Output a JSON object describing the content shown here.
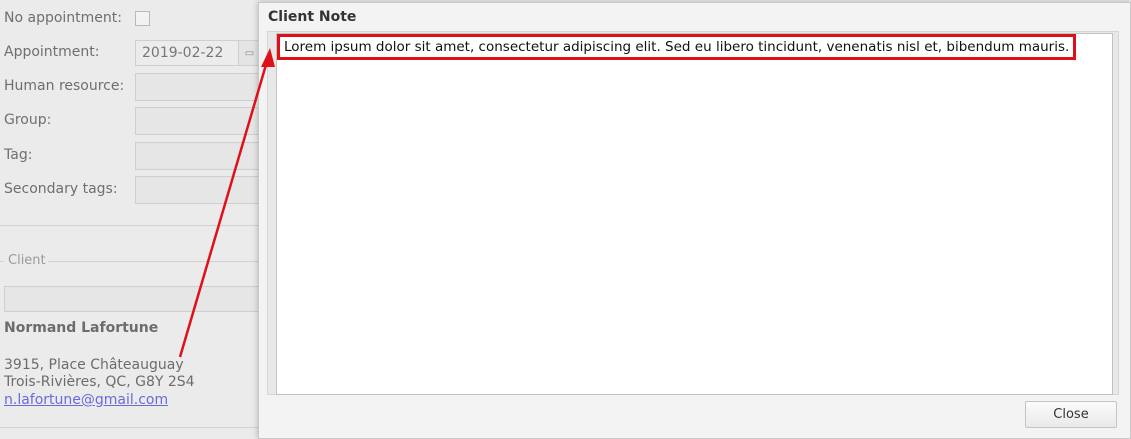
{
  "form": {
    "no_appointment_label": "No appointment:",
    "appointment_label": "Appointment:",
    "appointment_value": "2019-02-22",
    "human_resource_label": "Human resource:",
    "group_label": "Group:",
    "tag_label": "Tag:",
    "secondary_tags_label": "Secondary tags:"
  },
  "client": {
    "legend": "Client",
    "name": "Normand Lafortune",
    "address_line1": "3915, Place Châteauguay",
    "address_line2": "Trois-Rivières, QC, G8Y 2S4",
    "email": "n.lafortune@gmail.com"
  },
  "dialog": {
    "title": "Client Note",
    "note_text": "Lorem ipsum dolor sit amet, consectetur adipiscing elit. Sed eu libero tincidunt, venenatis nisl et, bibendum mauris.",
    "close_label": "Close"
  },
  "annotation": {
    "highlight_color": "#e0101a"
  }
}
